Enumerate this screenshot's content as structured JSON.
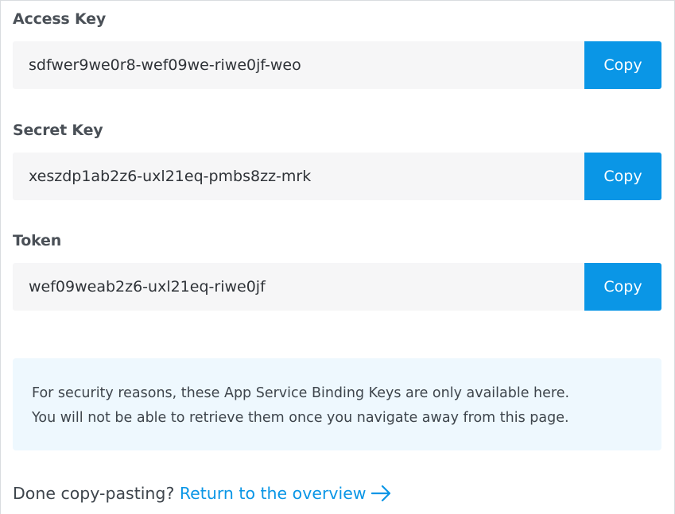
{
  "fields": [
    {
      "label": "Access Key",
      "value": "sdfwer9we0r8-wef09we-riwe0jf-weo",
      "button": "Copy"
    },
    {
      "label": "Secret Key",
      "value": "xeszdp1ab2z6-uxl21eq-pmbs8zz-mrk",
      "button": "Copy"
    },
    {
      "label": "Token",
      "value": "wef09weab2z6-uxl21eq-riwe0jf",
      "button": "Copy"
    }
  ],
  "notice": {
    "line1": "For security reasons, these App Service Binding Keys are only available here.",
    "line2": "You will not be able to retrieve them once you navigate away from this page."
  },
  "footer": {
    "prompt": "Done copy-pasting?",
    "link_label": "Return to the overview",
    "link_icon": "arrow-right-icon"
  },
  "colors": {
    "accent": "#0a96e6",
    "field_background": "#f6f6f7",
    "notice_background": "#eef8fe"
  }
}
